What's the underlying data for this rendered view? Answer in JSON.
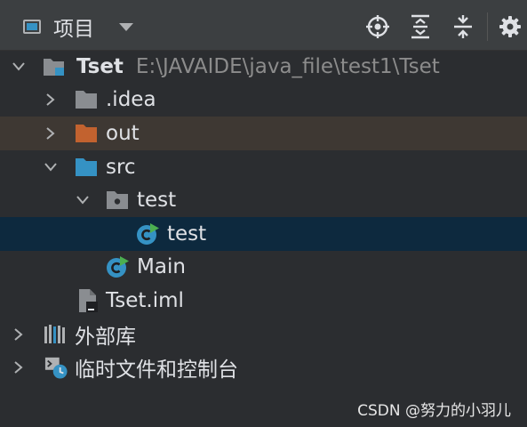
{
  "toolbar": {
    "title": "项目",
    "buttons": [
      "locate-icon",
      "expand-all-icon",
      "collapse-all-icon",
      "gear-icon"
    ]
  },
  "tree": {
    "root": {
      "name": "Tset",
      "path": "E:\\JAVAIDE\\java_file\\test1\\Tset"
    },
    "idea": ".idea",
    "out": "out",
    "src": "src",
    "test_pkg": "test",
    "test_class": "test",
    "main_class": "Main",
    "iml": "Tset.iml",
    "ext_libs": "外部库",
    "scratches": "临时文件和控制台"
  },
  "colors": {
    "background": "#2b2d30",
    "toolbar": "#3c3f41",
    "selected_row": "#0d293e",
    "out_row": "#3e3833",
    "folder_blue": "#3592c4",
    "folder_orange": "#c2622f",
    "folder_grey": "#8a8d91"
  },
  "watermark": "CSDN @努力的小羽儿"
}
